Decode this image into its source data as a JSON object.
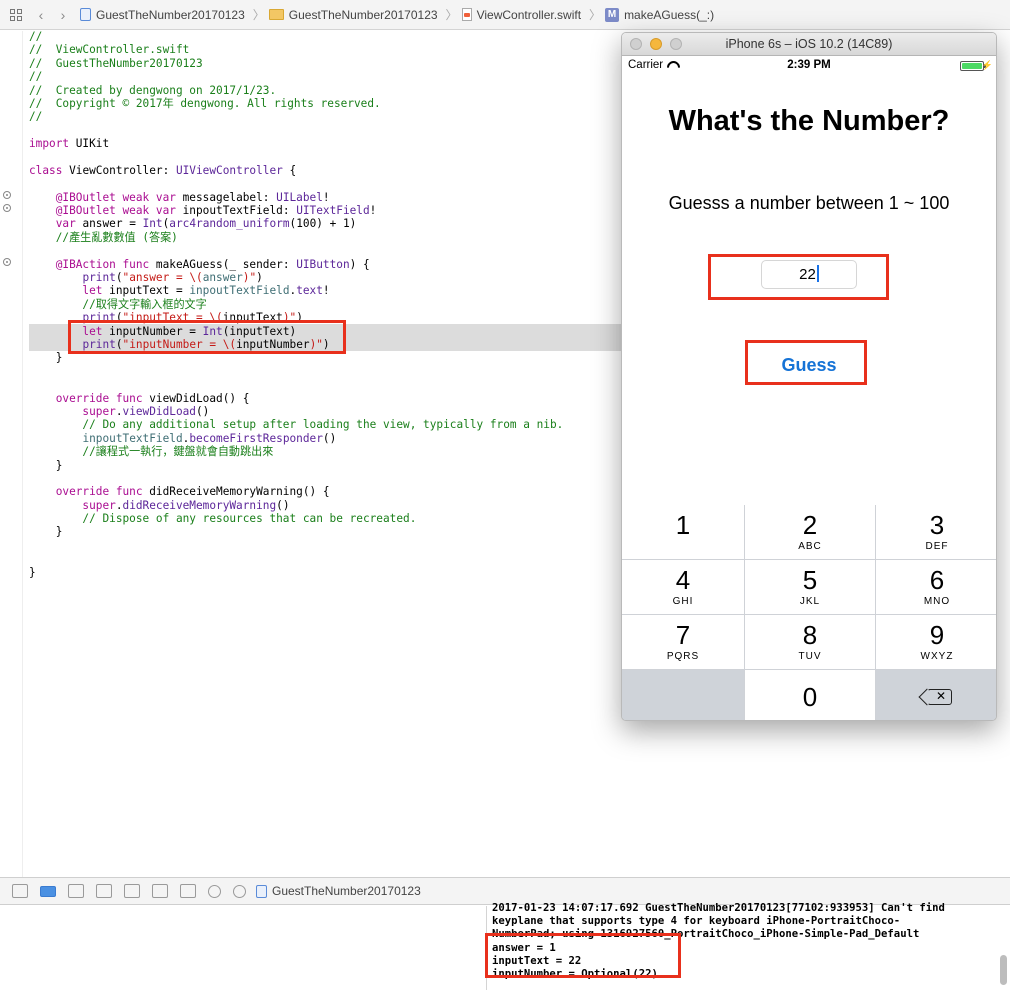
{
  "jumpbar": {
    "items": [
      {
        "label": "GuestTheNumber20170123"
      },
      {
        "label": "GuestTheNumber20170123"
      },
      {
        "label": "ViewController.swift"
      },
      {
        "label": "makeAGuess(_:)"
      }
    ]
  },
  "code_lines": [
    {
      "segments": [
        {
          "t": "//",
          "c": "comment"
        }
      ]
    },
    {
      "segments": [
        {
          "t": "//  ViewController.swift",
          "c": "comment"
        }
      ]
    },
    {
      "segments": [
        {
          "t": "//  GuestTheNumber20170123",
          "c": "comment"
        }
      ]
    },
    {
      "segments": [
        {
          "t": "//",
          "c": "comment"
        }
      ]
    },
    {
      "segments": [
        {
          "t": "//  Created by dengwong on 2017/1/23.",
          "c": "comment"
        }
      ]
    },
    {
      "segments": [
        {
          "t": "//  Copyright © 2017年 dengwong. All rights reserved.",
          "c": "comment"
        }
      ]
    },
    {
      "segments": [
        {
          "t": "//",
          "c": "comment"
        }
      ]
    },
    {
      "segments": []
    },
    {
      "segments": [
        {
          "t": "import",
          "c": "kw"
        },
        {
          "t": " UIKit",
          "c": ""
        }
      ]
    },
    {
      "segments": []
    },
    {
      "segments": [
        {
          "t": "class",
          "c": "kw"
        },
        {
          "t": " ViewController: ",
          "c": ""
        },
        {
          "t": "UIViewController",
          "c": "type"
        },
        {
          "t": " {",
          "c": ""
        }
      ]
    },
    {
      "segments": []
    },
    {
      "segments": [
        {
          "t": "    @IBOutlet weak var",
          "c": "kw"
        },
        {
          "t": " messagelabel: ",
          "c": ""
        },
        {
          "t": "UILabel",
          "c": "type"
        },
        {
          "t": "!",
          "c": ""
        }
      ]
    },
    {
      "segments": [
        {
          "t": "    @IBOutlet weak var",
          "c": "kw"
        },
        {
          "t": " inpoutTextField: ",
          "c": ""
        },
        {
          "t": "UITextField",
          "c": "type"
        },
        {
          "t": "!",
          "c": ""
        }
      ]
    },
    {
      "segments": [
        {
          "t": "    var",
          "c": "kw"
        },
        {
          "t": " answer = ",
          "c": ""
        },
        {
          "t": "Int",
          "c": "type"
        },
        {
          "t": "(",
          "c": ""
        },
        {
          "t": "arc4random_uniform",
          "c": "type"
        },
        {
          "t": "(100) + 1)",
          "c": ""
        }
      ]
    },
    {
      "segments": [
        {
          "t": "    //產生亂數數值 (答案)",
          "c": "comment"
        }
      ]
    },
    {
      "segments": []
    },
    {
      "segments": [
        {
          "t": "    @IBAction func",
          "c": "kw"
        },
        {
          "t": " makeAGuess(_ sender: ",
          "c": ""
        },
        {
          "t": "UIButton",
          "c": "type"
        },
        {
          "t": ") {",
          "c": ""
        }
      ]
    },
    {
      "segments": [
        {
          "t": "        ",
          "c": ""
        },
        {
          "t": "print",
          "c": "type"
        },
        {
          "t": "(",
          "c": ""
        },
        {
          "t": "\"answer = \\(",
          "c": "str"
        },
        {
          "t": "answer",
          "c": "proj"
        },
        {
          "t": ")\"",
          "c": "str"
        },
        {
          "t": ")",
          "c": ""
        }
      ]
    },
    {
      "segments": [
        {
          "t": "        let",
          "c": "kw"
        },
        {
          "t": " inputText = ",
          "c": ""
        },
        {
          "t": "inpoutTextField",
          "c": "proj"
        },
        {
          "t": ".",
          "c": ""
        },
        {
          "t": "text",
          "c": "type"
        },
        {
          "t": "!",
          "c": ""
        }
      ]
    },
    {
      "segments": [
        {
          "t": "        //取得文字輸入框的文字",
          "c": "comment"
        }
      ]
    },
    {
      "segments": [
        {
          "t": "        ",
          "c": ""
        },
        {
          "t": "print",
          "c": "type"
        },
        {
          "t": "(",
          "c": ""
        },
        {
          "t": "\"inputText = \\(",
          "c": "str"
        },
        {
          "t": "inputText",
          "c": ""
        },
        {
          "t": ")\"",
          "c": "str"
        },
        {
          "t": ")",
          "c": ""
        }
      ]
    },
    {
      "segments": [
        {
          "t": "        let",
          "c": "kw"
        },
        {
          "t": " inputNumber = ",
          "c": ""
        },
        {
          "t": "Int",
          "c": "type"
        },
        {
          "t": "(inputText)",
          "c": ""
        }
      ]
    },
    {
      "segments": [
        {
          "t": "        ",
          "c": ""
        },
        {
          "t": "print",
          "c": "type"
        },
        {
          "t": "(",
          "c": ""
        },
        {
          "t": "\"inputNumber = \\(",
          "c": "str"
        },
        {
          "t": "inputNumber",
          "c": ""
        },
        {
          "t": ")\"",
          "c": "str"
        },
        {
          "t": ")",
          "c": ""
        }
      ]
    },
    {
      "segments": [
        {
          "t": "    }",
          "c": ""
        }
      ]
    },
    {
      "segments": []
    },
    {
      "segments": []
    },
    {
      "segments": [
        {
          "t": "    override func",
          "c": "kw"
        },
        {
          "t": " viewDidLoad() {",
          "c": ""
        }
      ]
    },
    {
      "segments": [
        {
          "t": "        super",
          "c": "kw"
        },
        {
          "t": ".",
          "c": ""
        },
        {
          "t": "viewDidLoad",
          "c": "type"
        },
        {
          "t": "()",
          "c": ""
        }
      ]
    },
    {
      "segments": [
        {
          "t": "        // Do any additional setup after loading the view, typically from a nib.",
          "c": "comment"
        }
      ]
    },
    {
      "segments": [
        {
          "t": "        ",
          "c": ""
        },
        {
          "t": "inpoutTextField",
          "c": "proj"
        },
        {
          "t": ".",
          "c": ""
        },
        {
          "t": "becomeFirstResponder",
          "c": "type"
        },
        {
          "t": "()",
          "c": ""
        }
      ]
    },
    {
      "segments": [
        {
          "t": "        //讓程式一執行，鍵盤就會自動跳出來",
          "c": "comment"
        }
      ]
    },
    {
      "segments": [
        {
          "t": "    }",
          "c": ""
        }
      ]
    },
    {
      "segments": []
    },
    {
      "segments": [
        {
          "t": "    override func",
          "c": "kw"
        },
        {
          "t": " didReceiveMemoryWarning() {",
          "c": ""
        }
      ]
    },
    {
      "segments": [
        {
          "t": "        super",
          "c": "kw"
        },
        {
          "t": ".",
          "c": ""
        },
        {
          "t": "didReceiveMemoryWarning",
          "c": "type"
        },
        {
          "t": "()",
          "c": ""
        }
      ]
    },
    {
      "segments": [
        {
          "t": "        // Dispose of any resources that can be recreated.",
          "c": "comment"
        }
      ]
    },
    {
      "segments": [
        {
          "t": "    }",
          "c": ""
        }
      ]
    },
    {
      "segments": []
    },
    {
      "segments": []
    },
    {
      "segments": [
        {
          "t": "}",
          "c": ""
        }
      ]
    }
  ],
  "debugbar": {
    "target_label": "GuestTheNumber20170123"
  },
  "console": {
    "lines": [
      "2017-01-23 14:07:17.692 GuestTheNumber20170123[77102:933953] Can't find",
      "keyplane that supports type 4 for keyboard iPhone-PortraitChoco-",
      "NumberPad; using 1316927560_PortraitChoco_iPhone-Simple-Pad_Default",
      "answer = 1",
      "inputText = 22",
      "inputNumber = Optional(22)"
    ]
  },
  "simulator": {
    "title": "iPhone 6s – iOS 10.2 (14C89)",
    "status": {
      "carrier": "Carrier",
      "time": "2:39 PM"
    },
    "app": {
      "title": "What's the Number?",
      "message": "Guesss a number between 1 ~ 100",
      "input_value": "22",
      "button_label": "Guess"
    },
    "keypad": [
      {
        "digit": "1",
        "letters": ""
      },
      {
        "digit": "2",
        "letters": "ABC"
      },
      {
        "digit": "3",
        "letters": "DEF"
      },
      {
        "digit": "4",
        "letters": "GHI"
      },
      {
        "digit": "5",
        "letters": "JKL"
      },
      {
        "digit": "6",
        "letters": "MNO"
      },
      {
        "digit": "7",
        "letters": "PQRS"
      },
      {
        "digit": "8",
        "letters": "TUV"
      },
      {
        "digit": "9",
        "letters": "WXYZ"
      },
      {
        "digit": "0",
        "letters": ""
      }
    ]
  },
  "colors": {
    "annotation_red": "#e8301c",
    "accent_blue": "#1573d6",
    "comment_green": "#1a7f1a",
    "keyword_purple": "#aa0d91",
    "string_red": "#c41a16",
    "battery_green": "#4cd964"
  },
  "icons": [
    "grid-icon",
    "back-icon",
    "forward-icon",
    "project-icon",
    "folder-icon",
    "swift-file-icon",
    "method-icon",
    "breakpoint-icon",
    "wifi-icon",
    "battery-icon",
    "delete-key-icon"
  ]
}
